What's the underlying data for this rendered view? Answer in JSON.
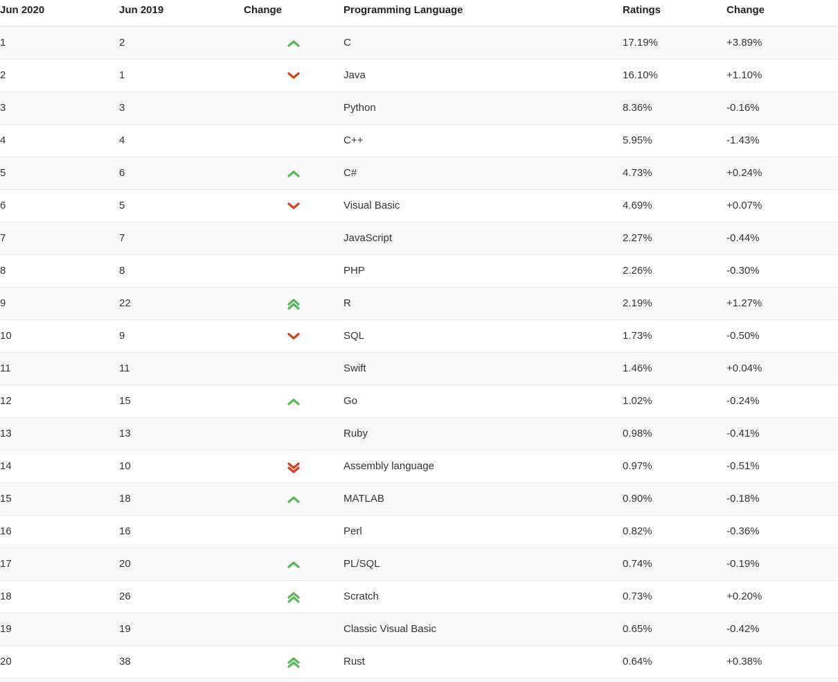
{
  "table": {
    "name": "tiobe-programming-language-index",
    "columns": [
      {
        "key": "rank_new",
        "label": "Jun 2020"
      },
      {
        "key": "rank_old",
        "label": "Jun 2019"
      },
      {
        "key": "change_icon",
        "label": "Change"
      },
      {
        "key": "language",
        "label": "Programming Language"
      },
      {
        "key": "ratings",
        "label": "Ratings"
      },
      {
        "key": "delta",
        "label": "Change"
      }
    ],
    "colors": {
      "arrow_up": "#5cb85c",
      "arrow_down": "#d9411e",
      "row_stripe": "#f9f9f9",
      "row_plain": "#ffffff",
      "border": "#e7e7e7",
      "header_text": "#222222",
      "body_text": "#333333"
    },
    "rows": [
      {
        "rank_new": "1",
        "rank_old": "2",
        "change_icon": "up-single",
        "language": "C",
        "ratings": "17.19%",
        "delta": "+3.89%"
      },
      {
        "rank_new": "2",
        "rank_old": "1",
        "change_icon": "down-single",
        "language": "Java",
        "ratings": "16.10%",
        "delta": "+1.10%"
      },
      {
        "rank_new": "3",
        "rank_old": "3",
        "change_icon": "none",
        "language": "Python",
        "ratings": "8.36%",
        "delta": "-0.16%"
      },
      {
        "rank_new": "4",
        "rank_old": "4",
        "change_icon": "none",
        "language": "C++",
        "ratings": "5.95%",
        "delta": "-1.43%"
      },
      {
        "rank_new": "5",
        "rank_old": "6",
        "change_icon": "up-single",
        "language": "C#",
        "ratings": "4.73%",
        "delta": "+0.24%"
      },
      {
        "rank_new": "6",
        "rank_old": "5",
        "change_icon": "down-single",
        "language": "Visual Basic",
        "ratings": "4.69%",
        "delta": "+0.07%"
      },
      {
        "rank_new": "7",
        "rank_old": "7",
        "change_icon": "none",
        "language": "JavaScript",
        "ratings": "2.27%",
        "delta": "-0.44%"
      },
      {
        "rank_new": "8",
        "rank_old": "8",
        "change_icon": "none",
        "language": "PHP",
        "ratings": "2.26%",
        "delta": "-0.30%"
      },
      {
        "rank_new": "9",
        "rank_old": "22",
        "change_icon": "up-double",
        "language": "R",
        "ratings": "2.19%",
        "delta": "+1.27%"
      },
      {
        "rank_new": "10",
        "rank_old": "9",
        "change_icon": "down-single",
        "language": "SQL",
        "ratings": "1.73%",
        "delta": "-0.50%"
      },
      {
        "rank_new": "11",
        "rank_old": "11",
        "change_icon": "none",
        "language": "Swift",
        "ratings": "1.46%",
        "delta": "+0.04%"
      },
      {
        "rank_new": "12",
        "rank_old": "15",
        "change_icon": "up-single",
        "language": "Go",
        "ratings": "1.02%",
        "delta": "-0.24%"
      },
      {
        "rank_new": "13",
        "rank_old": "13",
        "change_icon": "none",
        "language": "Ruby",
        "ratings": "0.98%",
        "delta": "-0.41%"
      },
      {
        "rank_new": "14",
        "rank_old": "10",
        "change_icon": "down-double",
        "language": "Assembly language",
        "ratings": "0.97%",
        "delta": "-0.51%"
      },
      {
        "rank_new": "15",
        "rank_old": "18",
        "change_icon": "up-single",
        "language": "MATLAB",
        "ratings": "0.90%",
        "delta": "-0.18%"
      },
      {
        "rank_new": "16",
        "rank_old": "16",
        "change_icon": "none",
        "language": "Perl",
        "ratings": "0.82%",
        "delta": "-0.36%"
      },
      {
        "rank_new": "17",
        "rank_old": "20",
        "change_icon": "up-single",
        "language": "PL/SQL",
        "ratings": "0.74%",
        "delta": "-0.19%"
      },
      {
        "rank_new": "18",
        "rank_old": "26",
        "change_icon": "up-double",
        "language": "Scratch",
        "ratings": "0.73%",
        "delta": "+0.20%"
      },
      {
        "rank_new": "19",
        "rank_old": "19",
        "change_icon": "none",
        "language": "Classic Visual Basic",
        "ratings": "0.65%",
        "delta": "-0.42%"
      },
      {
        "rank_new": "20",
        "rank_old": "38",
        "change_icon": "up-double",
        "language": "Rust",
        "ratings": "0.64%",
        "delta": "+0.38%"
      }
    ]
  }
}
